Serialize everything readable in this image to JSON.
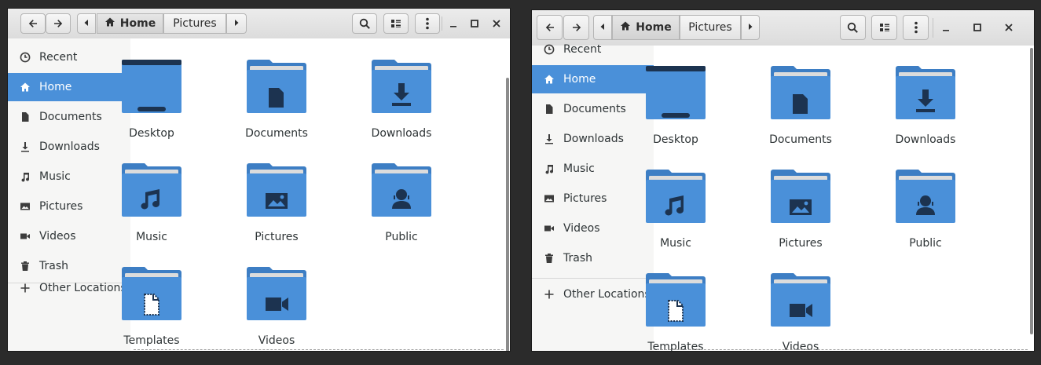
{
  "windows": [
    {
      "breadcrumb": {
        "home_label": "Home",
        "current_label": "Pictures"
      },
      "sidebar": {
        "items": [
          {
            "label": "Recent",
            "icon": "clock-icon",
            "active": false
          },
          {
            "label": "Home",
            "icon": "home-icon",
            "active": true
          },
          {
            "label": "Documents",
            "icon": "document-icon",
            "active": false
          },
          {
            "label": "Downloads",
            "icon": "download-icon",
            "active": false
          },
          {
            "label": "Music",
            "icon": "music-icon",
            "active": false
          },
          {
            "label": "Pictures",
            "icon": "image-icon",
            "active": false
          },
          {
            "label": "Videos",
            "icon": "video-icon",
            "active": false
          },
          {
            "label": "Trash",
            "icon": "trash-icon",
            "active": false
          }
        ],
        "other_locations": "Other Locations"
      },
      "folders": [
        {
          "label": "Desktop",
          "icon": "desktop"
        },
        {
          "label": "Documents",
          "icon": "document"
        },
        {
          "label": "Downloads",
          "icon": "download"
        },
        {
          "label": "Music",
          "icon": "music"
        },
        {
          "label": "Pictures",
          "icon": "image"
        },
        {
          "label": "Public",
          "icon": "person"
        },
        {
          "label": "Templates",
          "icon": "template"
        },
        {
          "label": "Videos",
          "icon": "video"
        }
      ]
    },
    {
      "breadcrumb": {
        "home_label": "Home",
        "current_label": "Pictures"
      },
      "sidebar": {
        "items": [
          {
            "label": "Recent",
            "icon": "clock-icon",
            "active": false
          },
          {
            "label": "Home",
            "icon": "home-icon",
            "active": true
          },
          {
            "label": "Documents",
            "icon": "document-icon",
            "active": false
          },
          {
            "label": "Downloads",
            "icon": "download-icon",
            "active": false
          },
          {
            "label": "Music",
            "icon": "music-icon",
            "active": false
          },
          {
            "label": "Pictures",
            "icon": "image-icon",
            "active": false
          },
          {
            "label": "Videos",
            "icon": "video-icon",
            "active": false
          },
          {
            "label": "Trash",
            "icon": "trash-icon",
            "active": false
          }
        ],
        "other_locations": "Other Locations"
      },
      "folders": [
        {
          "label": "Desktop",
          "icon": "desktop"
        },
        {
          "label": "Documents",
          "icon": "document"
        },
        {
          "label": "Downloads",
          "icon": "download"
        },
        {
          "label": "Music",
          "icon": "music"
        },
        {
          "label": "Pictures",
          "icon": "image"
        },
        {
          "label": "Public",
          "icon": "person"
        },
        {
          "label": "Templates",
          "icon": "template"
        },
        {
          "label": "Videos",
          "icon": "video"
        }
      ]
    }
  ],
  "colors": {
    "accent": "#4a90d9",
    "folder": "#4a90d9",
    "folder_dark": "#1c3350",
    "folder_tab": "#3d7ec4"
  }
}
